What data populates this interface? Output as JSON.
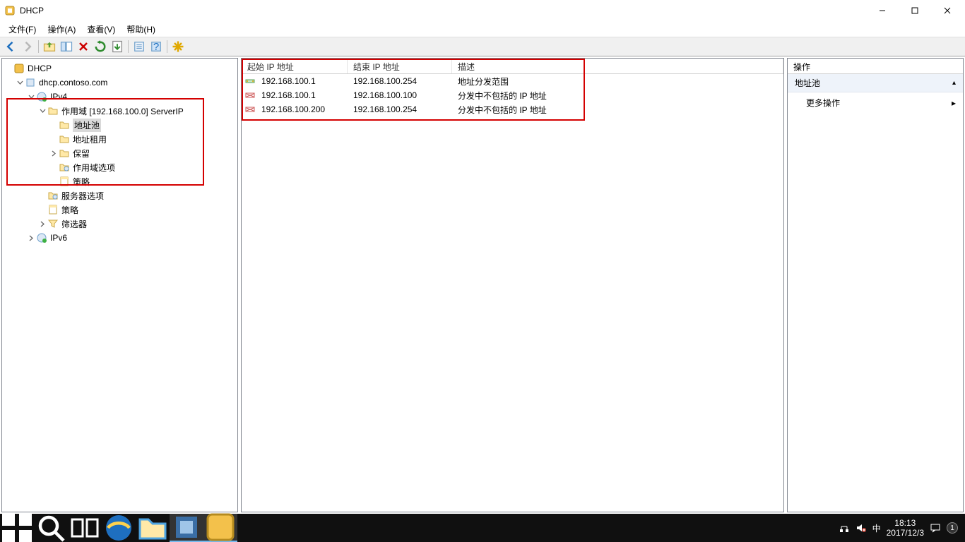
{
  "window": {
    "title": "DHCP"
  },
  "menu": {
    "file": "文件(F)",
    "action": "操作(A)",
    "view": "查看(V)",
    "help": "帮助(H)"
  },
  "tree": {
    "root": "DHCP",
    "server": "dhcp.contoso.com",
    "ipv4": "IPv4",
    "scope": "作用域 [192.168.100.0] ServerIP",
    "address_pool": "地址池",
    "leases": "地址租用",
    "reservations": "保留",
    "scope_options": "作用域选项",
    "policies_scope": "策略",
    "server_options": "服务器选项",
    "policies_server": "策略",
    "filters": "筛选器",
    "ipv6": "IPv6"
  },
  "list": {
    "columns": {
      "start": "起始 IP 地址",
      "end": "结束 IP 地址",
      "desc": "描述"
    },
    "rows": [
      {
        "start": "192.168.100.1",
        "end": "192.168.100.254",
        "desc": "地址分发范围",
        "kind": "range"
      },
      {
        "start": "192.168.100.1",
        "end": "192.168.100.100",
        "desc": "分发中不包括的 IP 地址",
        "kind": "excl"
      },
      {
        "start": "192.168.100.200",
        "end": "192.168.100.254",
        "desc": "分发中不包括的 IP 地址",
        "kind": "excl"
      }
    ]
  },
  "actions": {
    "title": "操作",
    "section": "地址池",
    "more": "更多操作"
  },
  "taskbar": {
    "time": "18:13",
    "date": "2017/12/3",
    "ime": "中"
  }
}
